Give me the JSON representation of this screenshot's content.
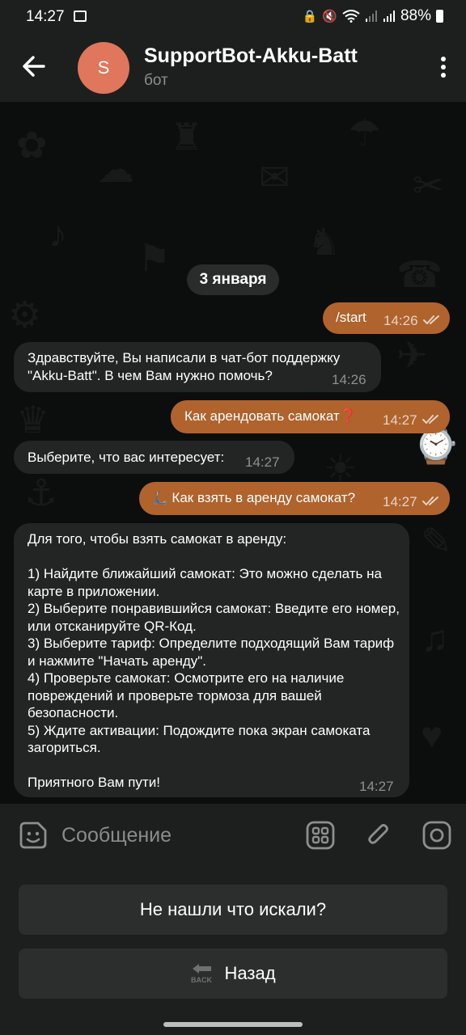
{
  "status_bar": {
    "time": "14:27",
    "battery": "88%"
  },
  "header": {
    "avatar_letter": "S",
    "title": "SupportBot-Akku-Batt",
    "subtitle": "бот"
  },
  "chat": {
    "date_separator": "3 января",
    "messages": [
      {
        "direction": "outgoing",
        "text": "/start",
        "time": "14:26"
      },
      {
        "direction": "incoming",
        "text": "Здравствуйте, Вы написали в чат-бот поддержку \"Akku-Batt\". В чем Вам нужно помочь?",
        "time": "14:26"
      },
      {
        "direction": "outgoing",
        "text": "Как арендовать самокат",
        "emoji": "❓",
        "time": "14:27"
      },
      {
        "direction": "incoming",
        "text": "Выберите, что вас интересует:",
        "time": "14:27"
      },
      {
        "direction": "outgoing",
        "emoji": "🛴",
        "text": "Как взять в аренду самокат?",
        "time": "14:27"
      },
      {
        "direction": "incoming",
        "text": "Для того, чтобы взять самокат в аренду:\n\n1) Найдите ближайший самокат: Это можно сделать на карте в приложении.\n2) Выберите понравившийся самокат: Введите его номер, или отсканируйте QR-Код.\n3) Выберите тариф: Определите подходящий Вам тариф и нажмите \"Начать аренду\".\n4) Проверьте самокат: Осмотрите его на наличие повреждений и проверьте тормоза для вашей безопасности.\n5) Ждите активации: Подождите пока экран самоката загориться.\n\nПриятного Вам пути!",
        "time": "14:27"
      }
    ]
  },
  "input": {
    "placeholder": "Сообщение"
  },
  "keyboard": {
    "buttons": [
      {
        "label": "Не нашли что искали?"
      },
      {
        "label": "Назад",
        "emoji_label": "BACK"
      }
    ]
  },
  "colors": {
    "outgoing_bubble": "#b0632d",
    "incoming_bubble": "#232524",
    "avatar": "#e0765c"
  }
}
